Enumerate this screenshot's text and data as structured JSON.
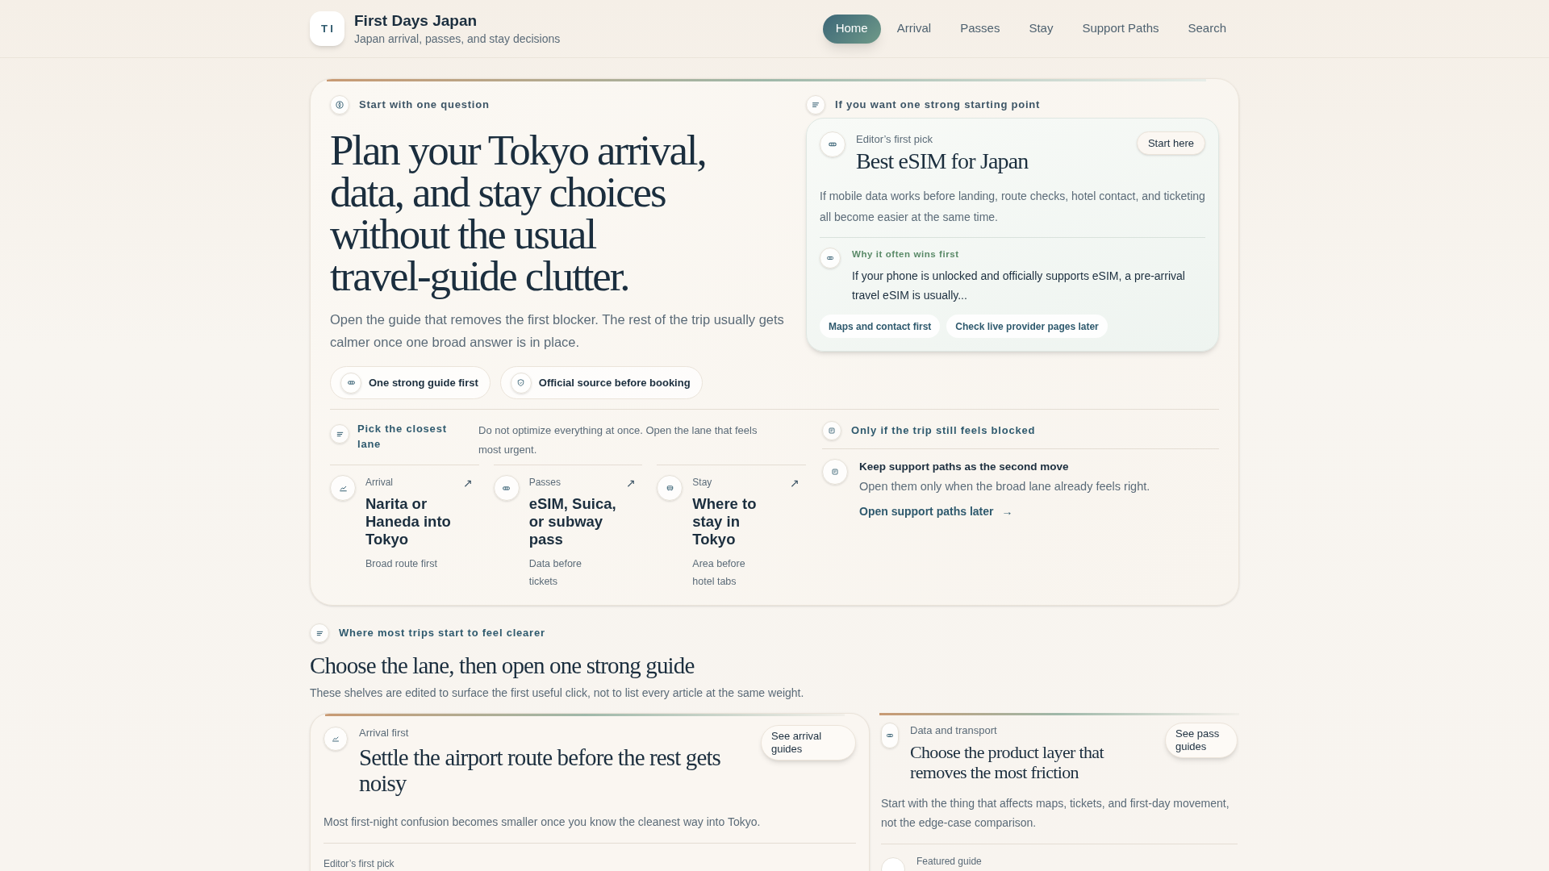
{
  "brand": {
    "logo": "TI",
    "title": "First Days Japan",
    "subtitle": "Japan arrival, passes, and stay decisions"
  },
  "nav": [
    {
      "label": "Home",
      "selected": true
    },
    {
      "label": "Arrival",
      "selected": false
    },
    {
      "label": "Passes",
      "selected": false
    },
    {
      "label": "Stay",
      "selected": false
    },
    {
      "label": "Support Paths",
      "selected": false
    },
    {
      "label": "Search",
      "selected": false
    }
  ],
  "hero": {
    "eyebrow": "Start with one question",
    "heading": "Plan your Tokyo arrival, data, and stay choices without the usual travel-guide clutter.",
    "lead": "Open the guide that removes the first blocker. The rest of the trip usually gets calmer once one broad answer is in place.",
    "chips": [
      "One strong guide first",
      "Official source before booking"
    ]
  },
  "pick": {
    "eyebrow": "If you want one strong starting point",
    "label": "Editor’s first pick",
    "title": "Best eSIM for Japan",
    "button": "Start here",
    "description": "If mobile data works before landing, route checks, hotel contact, and ticketing all become easier at the same time.",
    "why_label": "Why it often wins first",
    "why_text": "If your phone is unlocked and officially supports eSIM, a pre-arrival travel eSIM is usually...",
    "tags": [
      "Maps and contact first",
      "Check live provider pages later"
    ]
  },
  "lanes": {
    "eyebrow": "Pick the closest lane",
    "note": "Do not optimize everything at once. Open the lane that feels most urgent.",
    "items": [
      {
        "category": "Arrival",
        "title": "Narita or Haneda into Tokyo",
        "note": "Broad route first",
        "arrow": "↗"
      },
      {
        "category": "Passes",
        "title": "eSIM, Suica, or subway pass",
        "note": "Data before tickets",
        "arrow": "↗"
      },
      {
        "category": "Stay",
        "title": "Where to stay in Tokyo",
        "note": "Area before hotel tabs",
        "arrow": "↗"
      }
    ]
  },
  "blocked": {
    "eyebrow": "Only if the trip still feels blocked",
    "title": "Keep support paths as the second move",
    "text": "Open them only when the broad lane already feels right.",
    "link": "Open support paths later",
    "arrow": "→"
  },
  "shelves": {
    "eyebrow": "Where most trips start to feel clearer",
    "heading": "Choose the lane, then open one strong guide",
    "subtitle": "These shelves are edited to surface the first useful click, not to list every article at the same weight.",
    "cards": [
      {
        "category": "Arrival first",
        "title": "Settle the airport route before the rest gets noisy",
        "button": "See arrival guides",
        "description": "Most first-night confusion becomes smaller once you know the cleanest way into Tokyo.",
        "footer": "Editor’s first pick"
      },
      {
        "category": "Data and transport",
        "title": "Choose the product layer that removes the most friction",
        "button": "See pass guides",
        "description": "Start with the thing that affects maps, tickets, and first-day movement, not the edge-case comparison.",
        "footer": "Featured guide"
      }
    ]
  }
}
